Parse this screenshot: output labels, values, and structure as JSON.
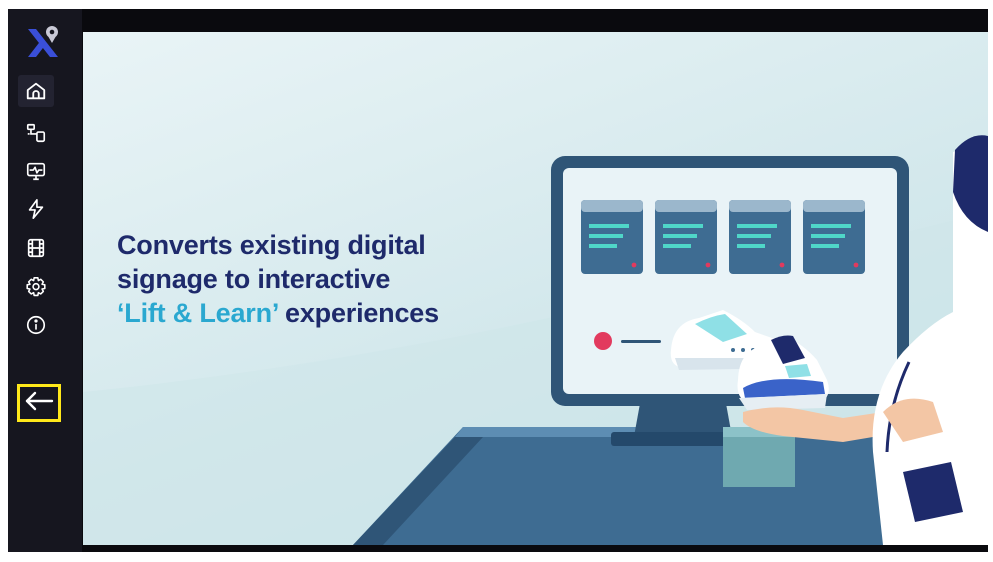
{
  "sidebar": {
    "logo_icon": "location-x-logo",
    "items": [
      {
        "name": "home",
        "icon": "home-icon",
        "active": true
      },
      {
        "name": "devices",
        "icon": "devices-icon"
      },
      {
        "name": "monitor",
        "icon": "monitor-pulse-icon"
      },
      {
        "name": "energy",
        "icon": "lightning-icon"
      },
      {
        "name": "media",
        "icon": "film-icon"
      },
      {
        "name": "settings",
        "icon": "gear-icon"
      },
      {
        "name": "info",
        "icon": "info-icon"
      }
    ],
    "back": {
      "icon": "arrow-left-icon",
      "highlight_color": "#ffe81a"
    }
  },
  "hero": {
    "headline_line1": "Converts existing digital",
    "headline_line2": "signage to interactive",
    "headline_accent": "‘Lift & Learn’",
    "headline_rest": " experiences",
    "colors": {
      "headline": "#1e2a6b",
      "accent": "#2aa8d0",
      "background": "#d3e8ec"
    }
  }
}
